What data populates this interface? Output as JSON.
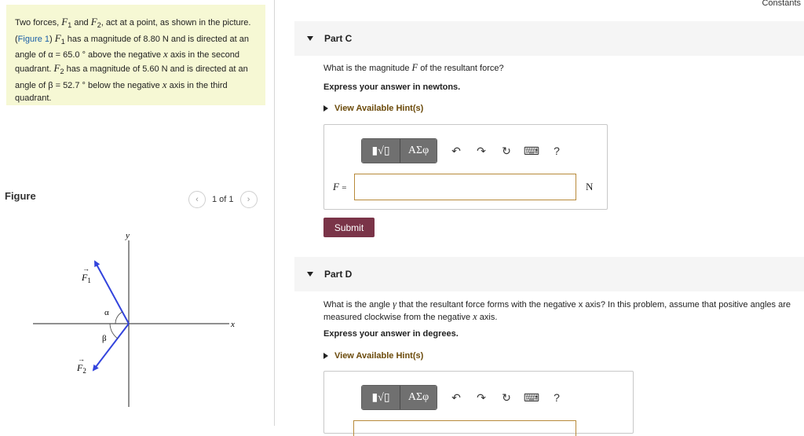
{
  "problem": {
    "t1": "Two forces, ",
    "f1": "F",
    "and": " and ",
    "f2": "F",
    "t2": ", act at a point, as shown in the picture. (",
    "figure_link": "Figure 1",
    "t3": ") ",
    "t4": " has a magnitude of 8.80 N and is directed at an angle of ",
    "alpha_eq": "α = 65.0 °",
    "t5": " above the negative ",
    "x1": "x",
    "t6": " axis in the second quadrant. ",
    "t7": " has a magnitude of 5.60 N and is directed at an angle of ",
    "beta_eq": "β = 52.7 °",
    "t8": " below the negative ",
    "x2": "x",
    "t9": " axis in the third quadrant."
  },
  "figure": {
    "label": "Figure",
    "pager": "1 of 1",
    "prev_icon": "chevron-left-icon",
    "next_icon": "chevron-right-icon",
    "axis_y": "y",
    "axis_x": "x",
    "f1_label": "F",
    "f2_label": "F",
    "alpha": "α",
    "beta": "β"
  },
  "constants_link": "Constants",
  "partC": {
    "title": "Part C",
    "question_pre": "What is the magnitude ",
    "question_var": "F",
    "question_post": " of the resultant force?",
    "instruction": "Express your answer in newtons.",
    "hint": "View Available Hint(s)",
    "input_label": "F",
    "input_eq": "=",
    "input_value": "",
    "unit": "N",
    "submit": "Submit",
    "toolbar": {
      "matrix": "▮√▯",
      "greek": "ΑΣφ",
      "help": "?"
    }
  },
  "partD": {
    "title": "Part D",
    "question_pre": "What is the angle ",
    "question_var": "γ",
    "question_post": " that the resultant force forms with the negative x axis? In this problem, assume that positive angles are measured clockwise from the negative ",
    "question_var2": "x",
    "question_end": " axis.",
    "instruction": "Express your answer in degrees.",
    "hint": "View Available Hint(s)",
    "toolbar": {
      "matrix": "▮√▯",
      "greek": "ΑΣφ",
      "help": "?"
    }
  },
  "colors": {
    "problem_bg": "#f6f8d4",
    "link": "#1a5fa8",
    "submit_bg": "#7a3448",
    "hint": "#6b4a0a",
    "vector": "#3344dd"
  }
}
